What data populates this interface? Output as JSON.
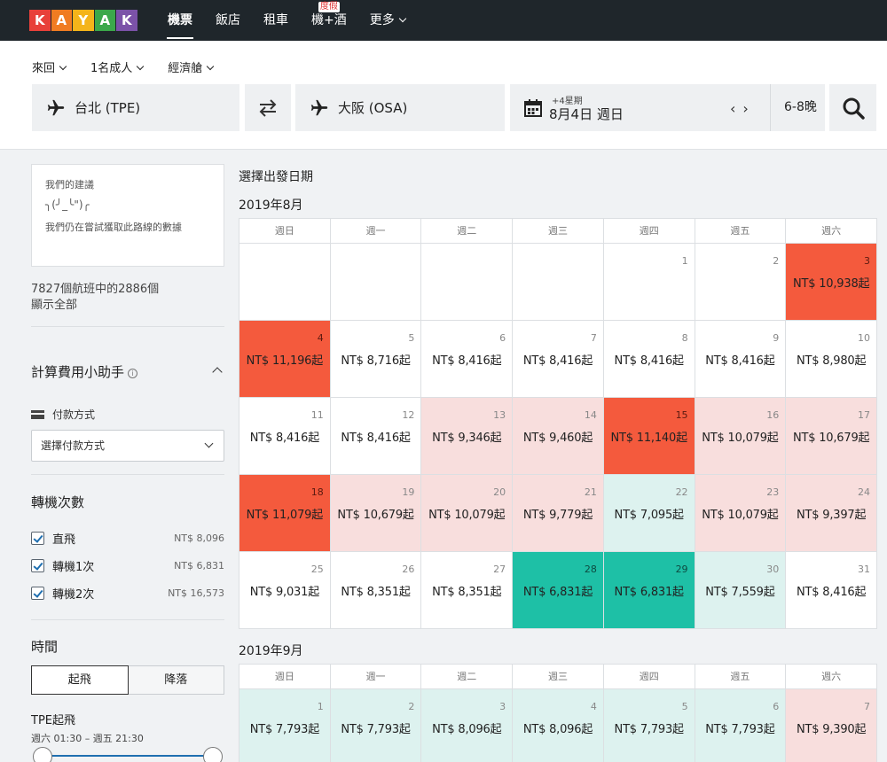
{
  "nav": {
    "logo_letters": [
      "K",
      "A",
      "Y",
      "A",
      "K"
    ],
    "logo_colors": [
      "#e8403a",
      "#f07c22",
      "#f4b41a",
      "#3ba84a",
      "#7b52a8"
    ],
    "items": [
      {
        "label": "機票",
        "active": true
      },
      {
        "label": "飯店"
      },
      {
        "label": "租車"
      },
      {
        "label": "機+酒",
        "badge": "度假"
      },
      {
        "label": "更多"
      }
    ]
  },
  "search": {
    "trip_type": "來回",
    "travelers": "1名成人",
    "cabin": "經濟艙",
    "origin": "台北 (TPE)",
    "destination": "大阪 (OSA)",
    "date_flex": "+4星期",
    "date": "8月4日 週日",
    "nights": "6-8晚"
  },
  "sidebar": {
    "advice_title": "我們的建議",
    "advice_face": "╮(╯_╰\")╭",
    "advice_text": "我們仍在嘗試獲取此路線的數據",
    "flight_count": "7827個航班中的2886個",
    "show_all": "顯示全部",
    "fee_title": "計算費用小助手",
    "info_glyph": "i",
    "payment_label": "付款方式",
    "payment_select": "選擇付款方式",
    "stops_title": "轉機次數",
    "stops": [
      {
        "label": "直飛",
        "price": "NT$ 8,096"
      },
      {
        "label": "轉機1次",
        "price": "NT$ 6,831"
      },
      {
        "label": "轉機2次",
        "price": "NT$ 16,573"
      }
    ],
    "time_title": "時間",
    "toggle_depart": "起飛",
    "toggle_arrive": "降落",
    "tpe_depart": "TPE起飛",
    "tpe_range": "週六 01:30 – 週五 21:30"
  },
  "calendar": {
    "title": "選擇出發日期",
    "weekdays": [
      "週日",
      "週一",
      "週二",
      "週三",
      "週四",
      "週五",
      "週六"
    ],
    "colors": {
      "hot": "#f45a3d",
      "pink": "#f8dedd",
      "mint": "#ddf2ef",
      "teal": "#1ec0a6"
    },
    "months": [
      {
        "label": "2019年8月",
        "days": [
          null,
          null,
          null,
          null,
          {
            "d": "1"
          },
          {
            "d": "2"
          },
          {
            "d": "3",
            "p": "NT$ 10,938起",
            "c": "hot"
          },
          {
            "d": "4",
            "p": "NT$ 11,196起",
            "c": "hot"
          },
          {
            "d": "5",
            "p": "NT$ 8,716起"
          },
          {
            "d": "6",
            "p": "NT$ 8,416起"
          },
          {
            "d": "7",
            "p": "NT$ 8,416起"
          },
          {
            "d": "8",
            "p": "NT$ 8,416起"
          },
          {
            "d": "9",
            "p": "NT$ 8,416起"
          },
          {
            "d": "10",
            "p": "NT$ 8,980起"
          },
          {
            "d": "11",
            "p": "NT$ 8,416起"
          },
          {
            "d": "12",
            "p": "NT$ 8,416起"
          },
          {
            "d": "13",
            "p": "NT$ 9,346起",
            "c": "pink"
          },
          {
            "d": "14",
            "p": "NT$ 9,460起",
            "c": "pink"
          },
          {
            "d": "15",
            "p": "NT$ 11,140起",
            "c": "hot"
          },
          {
            "d": "16",
            "p": "NT$ 10,079起",
            "c": "pink"
          },
          {
            "d": "17",
            "p": "NT$ 10,679起",
            "c": "pink"
          },
          {
            "d": "18",
            "p": "NT$ 11,079起",
            "c": "hot"
          },
          {
            "d": "19",
            "p": "NT$ 10,679起",
            "c": "pink"
          },
          {
            "d": "20",
            "p": "NT$ 10,079起",
            "c": "pink"
          },
          {
            "d": "21",
            "p": "NT$ 9,779起",
            "c": "pink"
          },
          {
            "d": "22",
            "p": "NT$ 7,095起",
            "c": "mint"
          },
          {
            "d": "23",
            "p": "NT$ 10,079起",
            "c": "pink"
          },
          {
            "d": "24",
            "p": "NT$ 9,397起",
            "c": "pink"
          },
          {
            "d": "25",
            "p": "NT$ 9,031起"
          },
          {
            "d": "26",
            "p": "NT$ 8,351起"
          },
          {
            "d": "27",
            "p": "NT$ 8,351起"
          },
          {
            "d": "28",
            "p": "NT$ 6,831起",
            "c": "teal"
          },
          {
            "d": "29",
            "p": "NT$ 6,831起",
            "c": "teal"
          },
          {
            "d": "30",
            "p": "NT$ 7,559起",
            "c": "mint"
          },
          {
            "d": "31",
            "p": "NT$ 8,416起"
          }
        ]
      },
      {
        "label": "2019年9月",
        "days": [
          {
            "d": "1",
            "p": "NT$ 7,793起",
            "c": "mint"
          },
          {
            "d": "2",
            "p": "NT$ 7,793起",
            "c": "mint"
          },
          {
            "d": "3",
            "p": "NT$ 8,096起",
            "c": "mint"
          },
          {
            "d": "4",
            "p": "NT$ 8,096起",
            "c": "mint"
          },
          {
            "d": "5",
            "p": "NT$ 7,793起",
            "c": "mint"
          },
          {
            "d": "6",
            "p": "NT$ 7,793起",
            "c": "mint"
          },
          {
            "d": "7",
            "p": "NT$ 9,390起",
            "c": "pink"
          }
        ]
      }
    ]
  }
}
